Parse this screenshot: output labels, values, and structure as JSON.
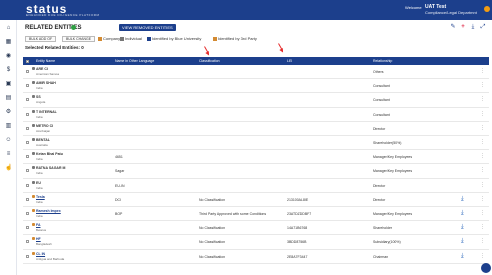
{
  "brand": {
    "name": "status",
    "subtitle": "ENHANCED DUE DILIGENCE PLATFORM"
  },
  "user": {
    "welcome": "Welcome",
    "name": "UAT Test",
    "subtitle": "Compliance/Legal Departmnt"
  },
  "page": {
    "title": "RELATED ENTITIES",
    "view_button": "VIEW REMOVED ENTITIES",
    "bulk_add": "BULK ADD OF",
    "bulk_change": "BULK CHANGE",
    "legend": [
      "Company",
      "Individual",
      "Identified by Blue University",
      "Identified by 3rd Party"
    ],
    "selected": "Selected Related Entities: 0"
  },
  "table": {
    "columns": [
      "Entity Name",
      "Name in Other Language",
      "Classification",
      "LEI",
      "Relationship"
    ],
    "rows": [
      {
        "name": "ARE CI",
        "sub": "American Samoa",
        "other": "",
        "classification": "",
        "lei": "",
        "relationship": "Others",
        "link": false,
        "download": false
      },
      {
        "name": "AMIR SHAH",
        "sub": "India",
        "other": "",
        "classification": "",
        "lei": "",
        "relationship": "Consultant",
        "link": false,
        "download": false
      },
      {
        "name": "SS",
        "sub": "Angola",
        "other": "",
        "classification": "",
        "lei": "",
        "relationship": "Consultant",
        "link": false,
        "download": false
      },
      {
        "name": "T INTERNAL",
        "sub": "India",
        "other": "",
        "classification": "",
        "lei": "",
        "relationship": "Consultant",
        "link": false,
        "download": false
      },
      {
        "name": "METRO CI",
        "sub": "Azerbaijan",
        "other": "",
        "classification": "",
        "lei": "",
        "relationship": "Director",
        "link": false,
        "download": false
      },
      {
        "name": "BENTAL",
        "sub": "Australia",
        "other": "",
        "classification": "",
        "lei": "",
        "relationship": "Shareholder(50%)",
        "link": false,
        "download": false
      },
      {
        "name": "Ketan Bhai Patu",
        "sub": "India",
        "other": "4651",
        "classification": "",
        "lei": "",
        "relationship": "Manager/Key Employees",
        "link": false,
        "download": false
      },
      {
        "name": "RATNA SAGAR M",
        "sub": "India",
        "other": "Sagar",
        "classification": "",
        "lei": "",
        "relationship": "Manager/Key Employees",
        "link": false,
        "download": false
      },
      {
        "name": "EU",
        "sub": "India",
        "other": "EU-IN",
        "classification": "",
        "lei": "",
        "relationship": "Director",
        "link": false,
        "download": false
      },
      {
        "name": "Tesla",
        "sub": "India",
        "other": "DCI",
        "classification": "No Classification",
        "lei": "213100AL8IE",
        "relationship": "Director",
        "link": true,
        "download": true
      },
      {
        "name": "Ramesh Impex",
        "sub": "India",
        "other": "BOP",
        "classification": "Third Party Approved with some Conditions",
        "lei": "23ATDZDDBF7",
        "relationship": "Manager/Key Employees",
        "link": true,
        "download": true
      },
      {
        "name": "FA",
        "sub": "Belarus",
        "other": "",
        "classification": "No Classification",
        "lei": "14A71B6768",
        "relationship": "Shareholder",
        "link": true,
        "download": true
      },
      {
        "name": "HF",
        "sub": "Bangladesh",
        "other": "",
        "classification": "No Classification",
        "lei": "3BDD8756B",
        "relationship": "Subsidiary(100%)",
        "link": true,
        "download": true
      },
      {
        "name": "CL IN",
        "sub": "Antigua and Barbuda",
        "other": "",
        "classification": "No Classification",
        "lei": "2E8A7F3447",
        "relationship": "Chairman",
        "link": true,
        "download": true
      }
    ]
  },
  "colors": {
    "primary": "#1c3f8c",
    "accent": "#e0314e",
    "success": "#2ea043",
    "annotation_arrow": "#e52b2b"
  },
  "icons": {
    "sidebar": [
      "home-icon",
      "grid-icon",
      "eye-icon",
      "dollar-icon",
      "clipboard-icon",
      "book-icon",
      "settings-icon",
      "chart-icon",
      "user-gear-icon",
      "list-icon",
      "hand-icon"
    ],
    "toolbar": [
      "edit-icon",
      "add-icon",
      "download-icon",
      "expand-icon"
    ]
  }
}
